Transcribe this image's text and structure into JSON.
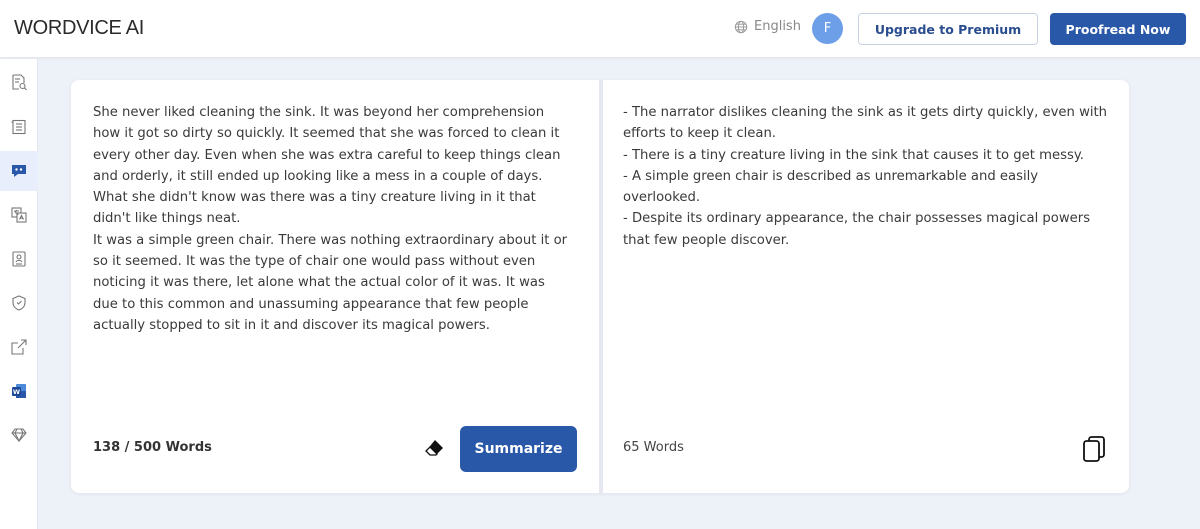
{
  "header": {
    "logo": "WORDVICE AI",
    "language": "English",
    "avatar_initial": "F",
    "upgrade_label": "Upgrade to Premium",
    "proofread_label": "Proofread Now"
  },
  "sidebar": {
    "items": [
      {
        "icon": "document-search-icon",
        "active": false
      },
      {
        "icon": "document-lines-icon",
        "active": false
      },
      {
        "icon": "quote-bubble-icon",
        "active": true
      },
      {
        "icon": "translate-icon",
        "active": false
      },
      {
        "icon": "id-badge-icon",
        "active": false
      },
      {
        "icon": "shield-icon",
        "active": false
      },
      {
        "icon": "external-link-icon",
        "active": false
      },
      {
        "icon": "word-app-icon",
        "active": false
      },
      {
        "icon": "diamond-icon",
        "active": false
      }
    ]
  },
  "input_panel": {
    "text": "She never liked cleaning the sink. It was beyond her comprehension how it got so dirty so quickly. It seemed that she was forced to clean it every other day. Even when she was extra careful to keep things clean and orderly, it still ended up looking like a mess in a couple of days. What she didn't know was there was a tiny creature living in it that didn't like things neat.\nIt was a simple green chair. There was nothing extraordinary about it or so it seemed. It was the type of chair one would pass without even noticing it was there, let alone what the actual color of it was. It was due to this common and unassuming appearance that few people actually stopped to sit in it and discover its magical powers.",
    "word_count": "138 / 500 Words",
    "summarize_label": "Summarize"
  },
  "output_panel": {
    "text": "- The narrator dislikes cleaning the sink as it gets dirty quickly, even with efforts to keep it clean.\n- There is a tiny creature living in the sink that causes it to get messy.\n- A simple green chair is described as unremarkable and easily overlooked.\n- Despite its ordinary appearance, the chair possesses magical powers that few people discover.",
    "word_count": "65 Words"
  },
  "colors": {
    "primary": "#2a58a8",
    "avatar": "#6d9ee8",
    "background": "#edf1f8"
  }
}
